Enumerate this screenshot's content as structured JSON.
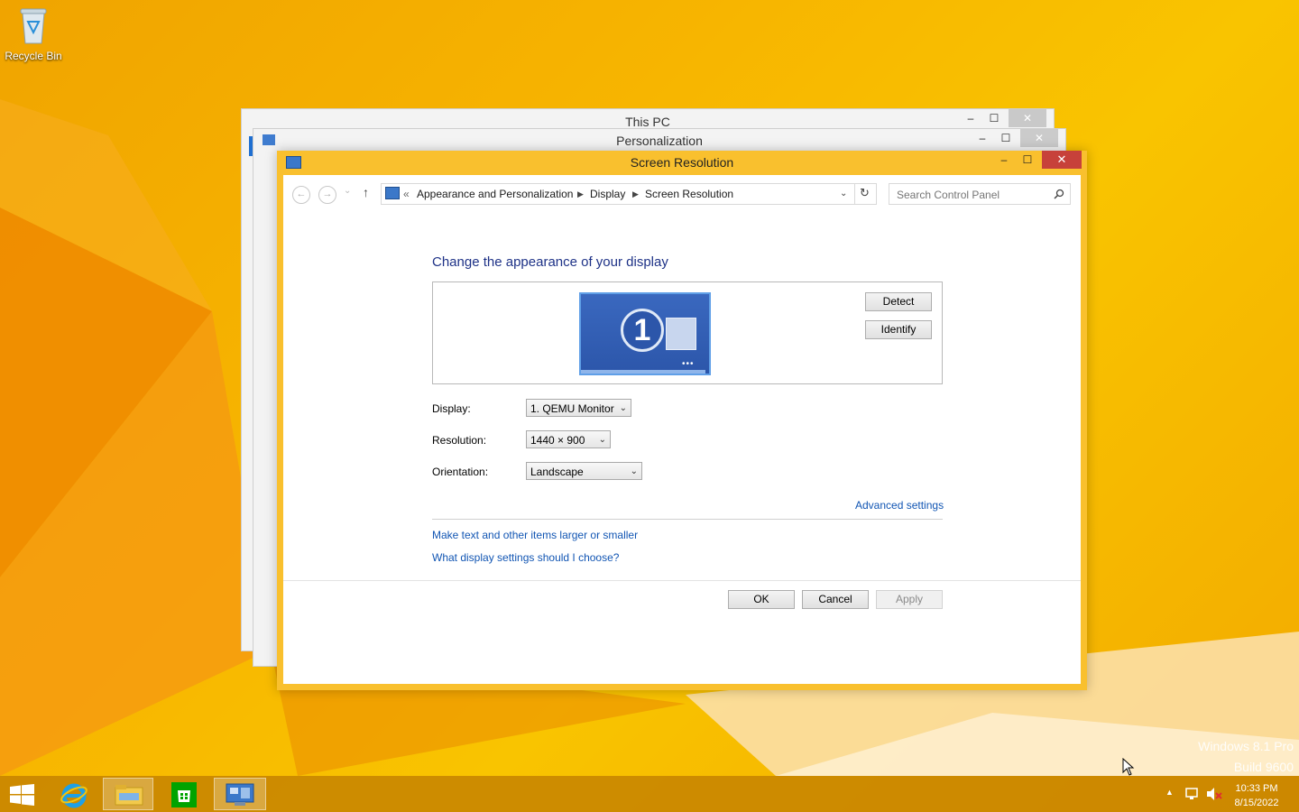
{
  "desktop": {
    "recycle_bin_label": "Recycle Bin",
    "watermark_line1": "Windows 8.1 Pro",
    "watermark_line2": "Build 9600"
  },
  "back_windows": {
    "this_pc_title": "This PC",
    "personalization_title": "Personalization"
  },
  "window": {
    "title": "Screen Resolution",
    "minimize": "–",
    "maximize": "☐",
    "close": "✕"
  },
  "nav": {
    "back": "←",
    "forward": "→",
    "recent": "⌄",
    "up": "↑",
    "overflow": "«",
    "breadcrumb": [
      "Appearance and Personalization",
      "Display",
      "Screen Resolution"
    ],
    "refresh": "↻",
    "search_placeholder": "Search Control Panel"
  },
  "content": {
    "heading": "Change the appearance of your display",
    "monitor_number": "1",
    "detect_label": "Detect",
    "identify_label": "Identify",
    "display_label": "Display:",
    "display_value": "1. QEMU Monitor",
    "resolution_label": "Resolution:",
    "resolution_value": "1440 × 900",
    "orientation_label": "Orientation:",
    "orientation_value": "Landscape",
    "advanced_settings": "Advanced settings",
    "link_text_size": "Make text and other items larger or smaller",
    "link_display_help": "What display settings should I choose?",
    "ok_label": "OK",
    "cancel_label": "Cancel",
    "apply_label": "Apply"
  },
  "taskbar": {
    "time": "10:33 PM",
    "date": "8/15/2022",
    "tray_overflow": "▲"
  },
  "colors": {
    "accent_title": "#1e3287",
    "link": "#1155b3",
    "close_red": "#c7413a",
    "window_frame": "#f9c02e"
  }
}
